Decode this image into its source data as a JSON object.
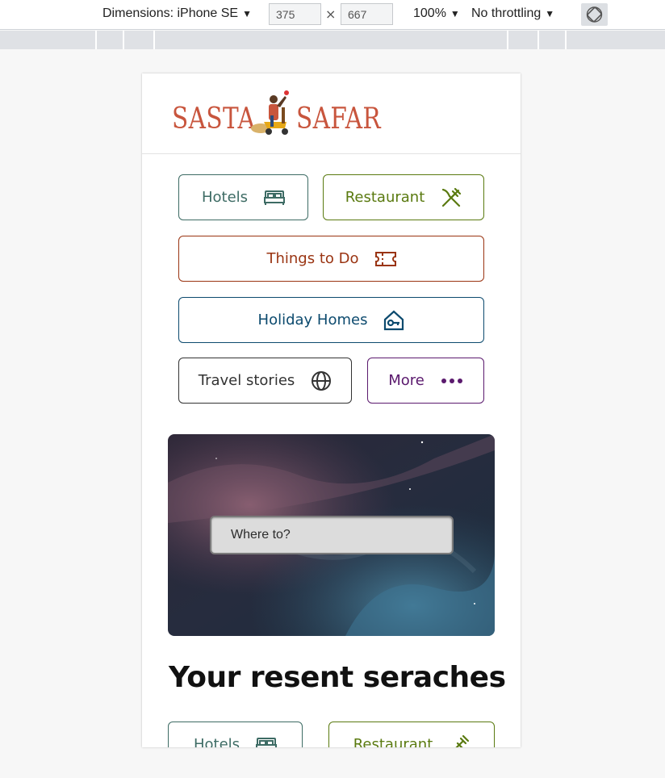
{
  "devtools": {
    "dimensions_label": "Dimensions: iPhone SE",
    "width_value": "375",
    "height_value": "667",
    "times": "×",
    "zoom": "100%",
    "throttling": "No throttling",
    "caret": "▼"
  },
  "brand": {
    "name_left": "SASTA",
    "name_right": "SAFAR",
    "color": "#c8553d"
  },
  "nav": {
    "hotels": {
      "label": "Hotels",
      "color": "#3d6b64",
      "icon": "bed-icon"
    },
    "restaurant": {
      "label": "Restaurant",
      "color": "#5a7a10",
      "icon": "utensils-icon"
    },
    "things_to_do": {
      "label": "Things to Do",
      "color": "#9a3412",
      "icon": "ticket-icon"
    },
    "holiday_homes": {
      "label": "Holiday Homes",
      "color": "#0c4a6e",
      "icon": "house-key-icon"
    },
    "travel_stories": {
      "label": "Travel stories",
      "color": "#333333",
      "icon": "globe-icon"
    },
    "more": {
      "label": "More",
      "color": "#5b1a6e",
      "icon": "ellipsis-icon"
    }
  },
  "search": {
    "placeholder": "Where to?"
  },
  "recent": {
    "title": "Your resent seraches",
    "items": [
      {
        "label": "Hotels",
        "color": "#3d6b64",
        "icon": "bed-icon"
      },
      {
        "label": "Restaurant",
        "color": "#5a7a10",
        "icon": "utensils-icon"
      }
    ]
  }
}
